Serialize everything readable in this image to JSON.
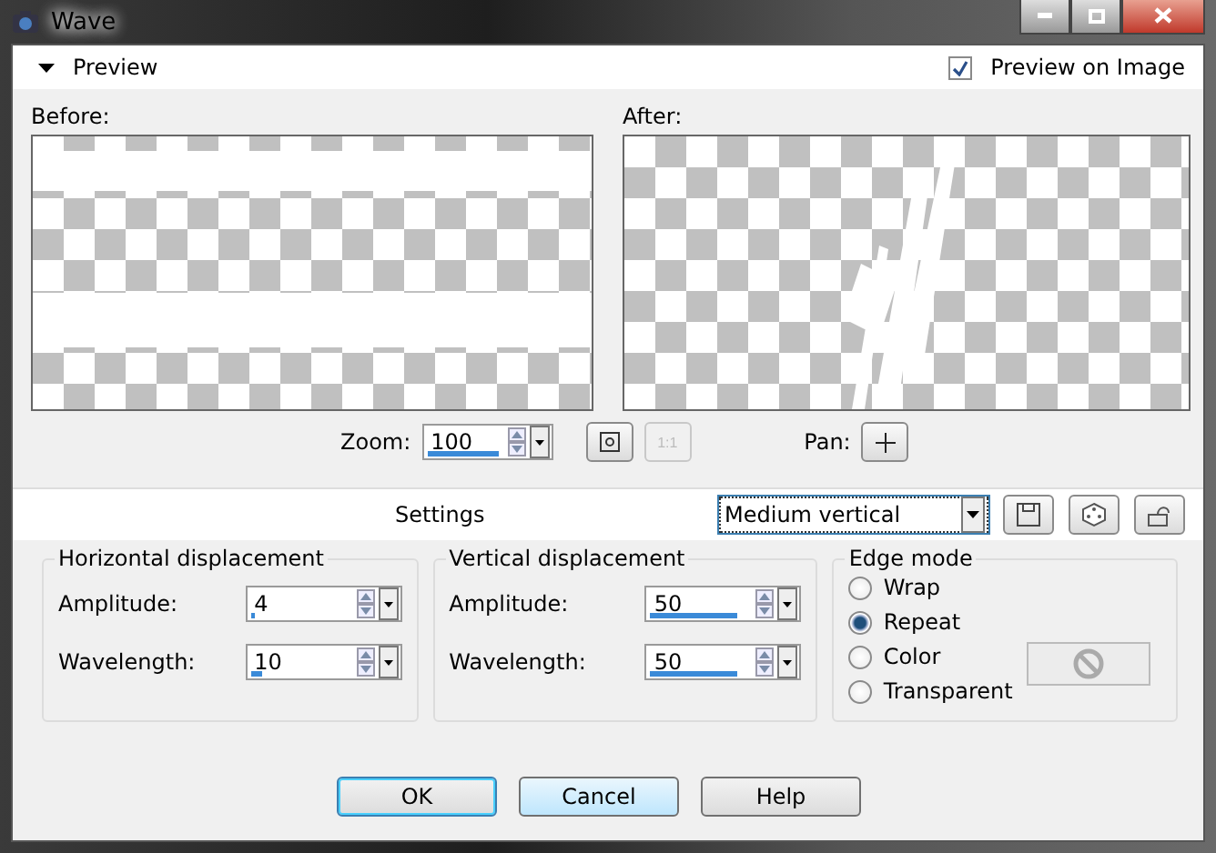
{
  "window": {
    "title": "Wave"
  },
  "preview": {
    "label": "Preview",
    "expanded": true,
    "preview_on_image": {
      "label": "Preview on Image",
      "checked": true
    },
    "before_label": "Before:",
    "after_label": "After:",
    "zoom": {
      "label": "Zoom:",
      "value": "100",
      "level": 0.6
    },
    "actual_size": {
      "label": "1:1",
      "disabled": true
    },
    "pan_label": "Pan:"
  },
  "settings": {
    "label": "Settings",
    "preset": "Medium vertical"
  },
  "groups": [
    {
      "title": "Horizontal displacement",
      "fields": [
        {
          "label": "Amplitude:",
          "value": "4",
          "level": 0.02
        },
        {
          "label": "Wavelength:",
          "value": "10",
          "level": 0.08
        }
      ]
    },
    {
      "title": "Vertical displacement",
      "fields": [
        {
          "label": "Amplitude:",
          "value": "50",
          "level": 0.6
        },
        {
          "label": "Wavelength:",
          "value": "50",
          "level": 0.6
        }
      ]
    }
  ],
  "edge_mode": {
    "title": "Edge mode",
    "options": [
      {
        "label": "Wrap",
        "selected": false
      },
      {
        "label": "Repeat",
        "selected": true
      },
      {
        "label": "Color",
        "selected": false
      },
      {
        "label": "Transparent",
        "selected": false
      }
    ],
    "color_disabled": true
  },
  "buttons": [
    {
      "label": "OK",
      "kind": "default"
    },
    {
      "label": "Cancel",
      "kind": "hover"
    },
    {
      "label": "Help",
      "kind": "normal"
    }
  ]
}
